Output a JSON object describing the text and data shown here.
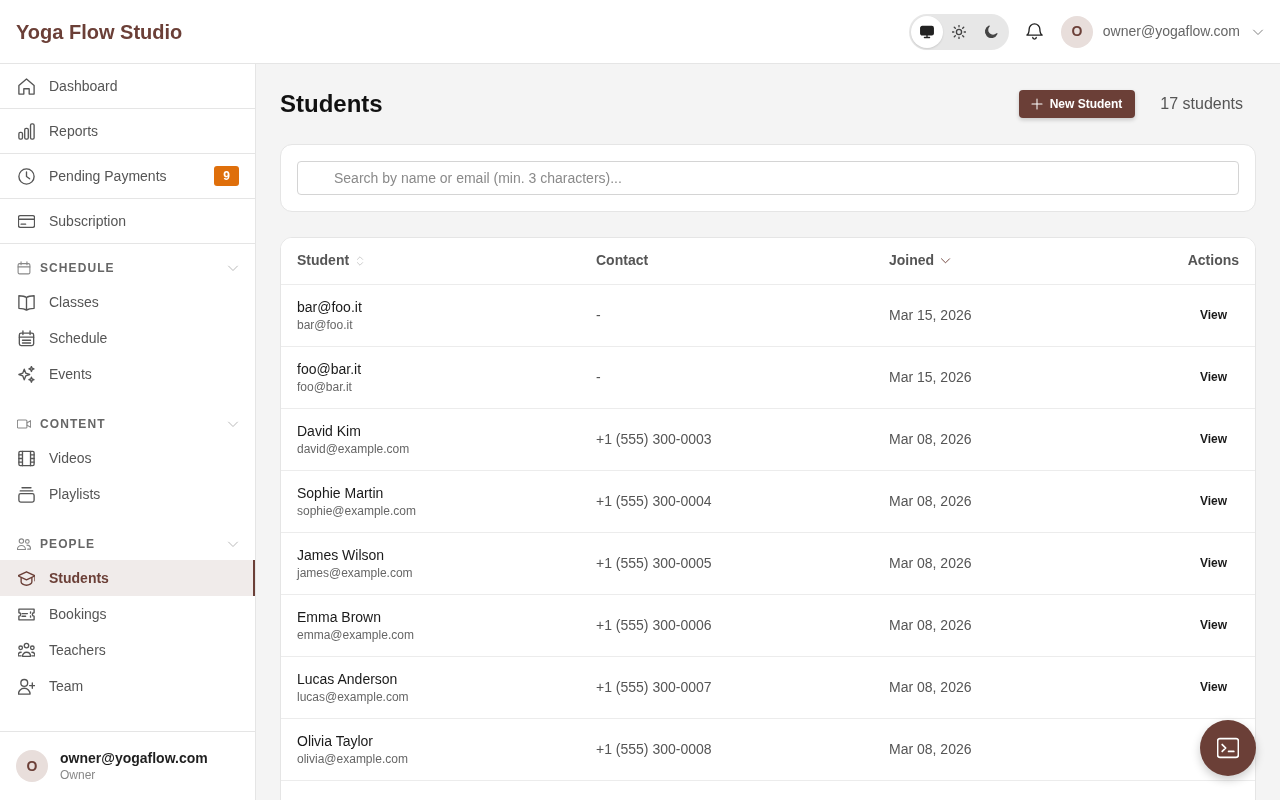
{
  "topbar": {
    "brand": "Yoga Flow Studio",
    "theme_options": [
      {
        "kind": "system",
        "selected": true
      },
      {
        "kind": "light",
        "selected": false
      },
      {
        "kind": "dark",
        "selected": false
      }
    ],
    "user": {
      "avatar": "O",
      "email": "owner@yogaflow.com"
    }
  },
  "sidebar": {
    "items": [
      {
        "label": "Dashboard",
        "selected": false
      },
      {
        "label": "Reports",
        "selected": false
      },
      {
        "label": "Pending Payments",
        "selected": false,
        "badge": "9"
      },
      {
        "label": "Subscription",
        "selected": false
      }
    ],
    "groups": [
      {
        "title": "SCHEDULE",
        "expanded": true,
        "items": [
          {
            "label": "Classes",
            "selected": false
          },
          {
            "label": "Schedule",
            "selected": false
          },
          {
            "label": "Events",
            "selected": false
          }
        ]
      },
      {
        "title": "CONTENT",
        "expanded": true,
        "items": [
          {
            "label": "Videos",
            "selected": false
          },
          {
            "label": "Playlists",
            "selected": false
          }
        ]
      },
      {
        "title": "PEOPLE",
        "expanded": true,
        "items": [
          {
            "label": "Students",
            "selected": true
          },
          {
            "label": "Bookings",
            "selected": false
          },
          {
            "label": "Teachers",
            "selected": false
          },
          {
            "label": "Team",
            "selected": false
          }
        ]
      }
    ],
    "account": {
      "avatar": "O",
      "email": "owner@yogaflow.com",
      "role": "Owner"
    }
  },
  "page": {
    "title": "Students",
    "new_button": "New Student",
    "count": "17 students",
    "search": {
      "placeholder": "Search by name or email (min. 3 characters)..."
    },
    "table": {
      "columns": [
        {
          "label": "Student",
          "sortable": true,
          "sorted": false
        },
        {
          "label": "Contact",
          "sortable": false,
          "sorted": false
        },
        {
          "label": "Joined",
          "sortable": true,
          "sorted": true,
          "descending": true
        },
        {
          "label": "Actions",
          "sortable": false,
          "sorted": false
        }
      ],
      "rows": [
        {
          "name": "bar@foo.it",
          "email": "bar@foo.it",
          "contact": "-",
          "joined": "Mar 15, 2026",
          "action": "View"
        },
        {
          "name": "foo@bar.it",
          "email": "foo@bar.it",
          "contact": "-",
          "joined": "Mar 15, 2026",
          "action": "View"
        },
        {
          "name": "David Kim",
          "email": "david@example.com",
          "contact": "+1 (555) 300-0003",
          "joined": "Mar 08, 2026",
          "action": "View"
        },
        {
          "name": "Sophie Martin",
          "email": "sophie@example.com",
          "contact": "+1 (555) 300-0004",
          "joined": "Mar 08, 2026",
          "action": "View"
        },
        {
          "name": "James Wilson",
          "email": "james@example.com",
          "contact": "+1 (555) 300-0005",
          "joined": "Mar 08, 2026",
          "action": "View"
        },
        {
          "name": "Emma Brown",
          "email": "emma@example.com",
          "contact": "+1 (555) 300-0006",
          "joined": "Mar 08, 2026",
          "action": "View"
        },
        {
          "name": "Lucas Anderson",
          "email": "lucas@example.com",
          "contact": "+1 (555) 300-0007",
          "joined": "Mar 08, 2026",
          "action": "View"
        },
        {
          "name": "Olivia Taylor",
          "email": "olivia@example.com",
          "contact": "+1 (555) 300-0008",
          "joined": "Mar 08, 2026"
        }
      ]
    }
  }
}
